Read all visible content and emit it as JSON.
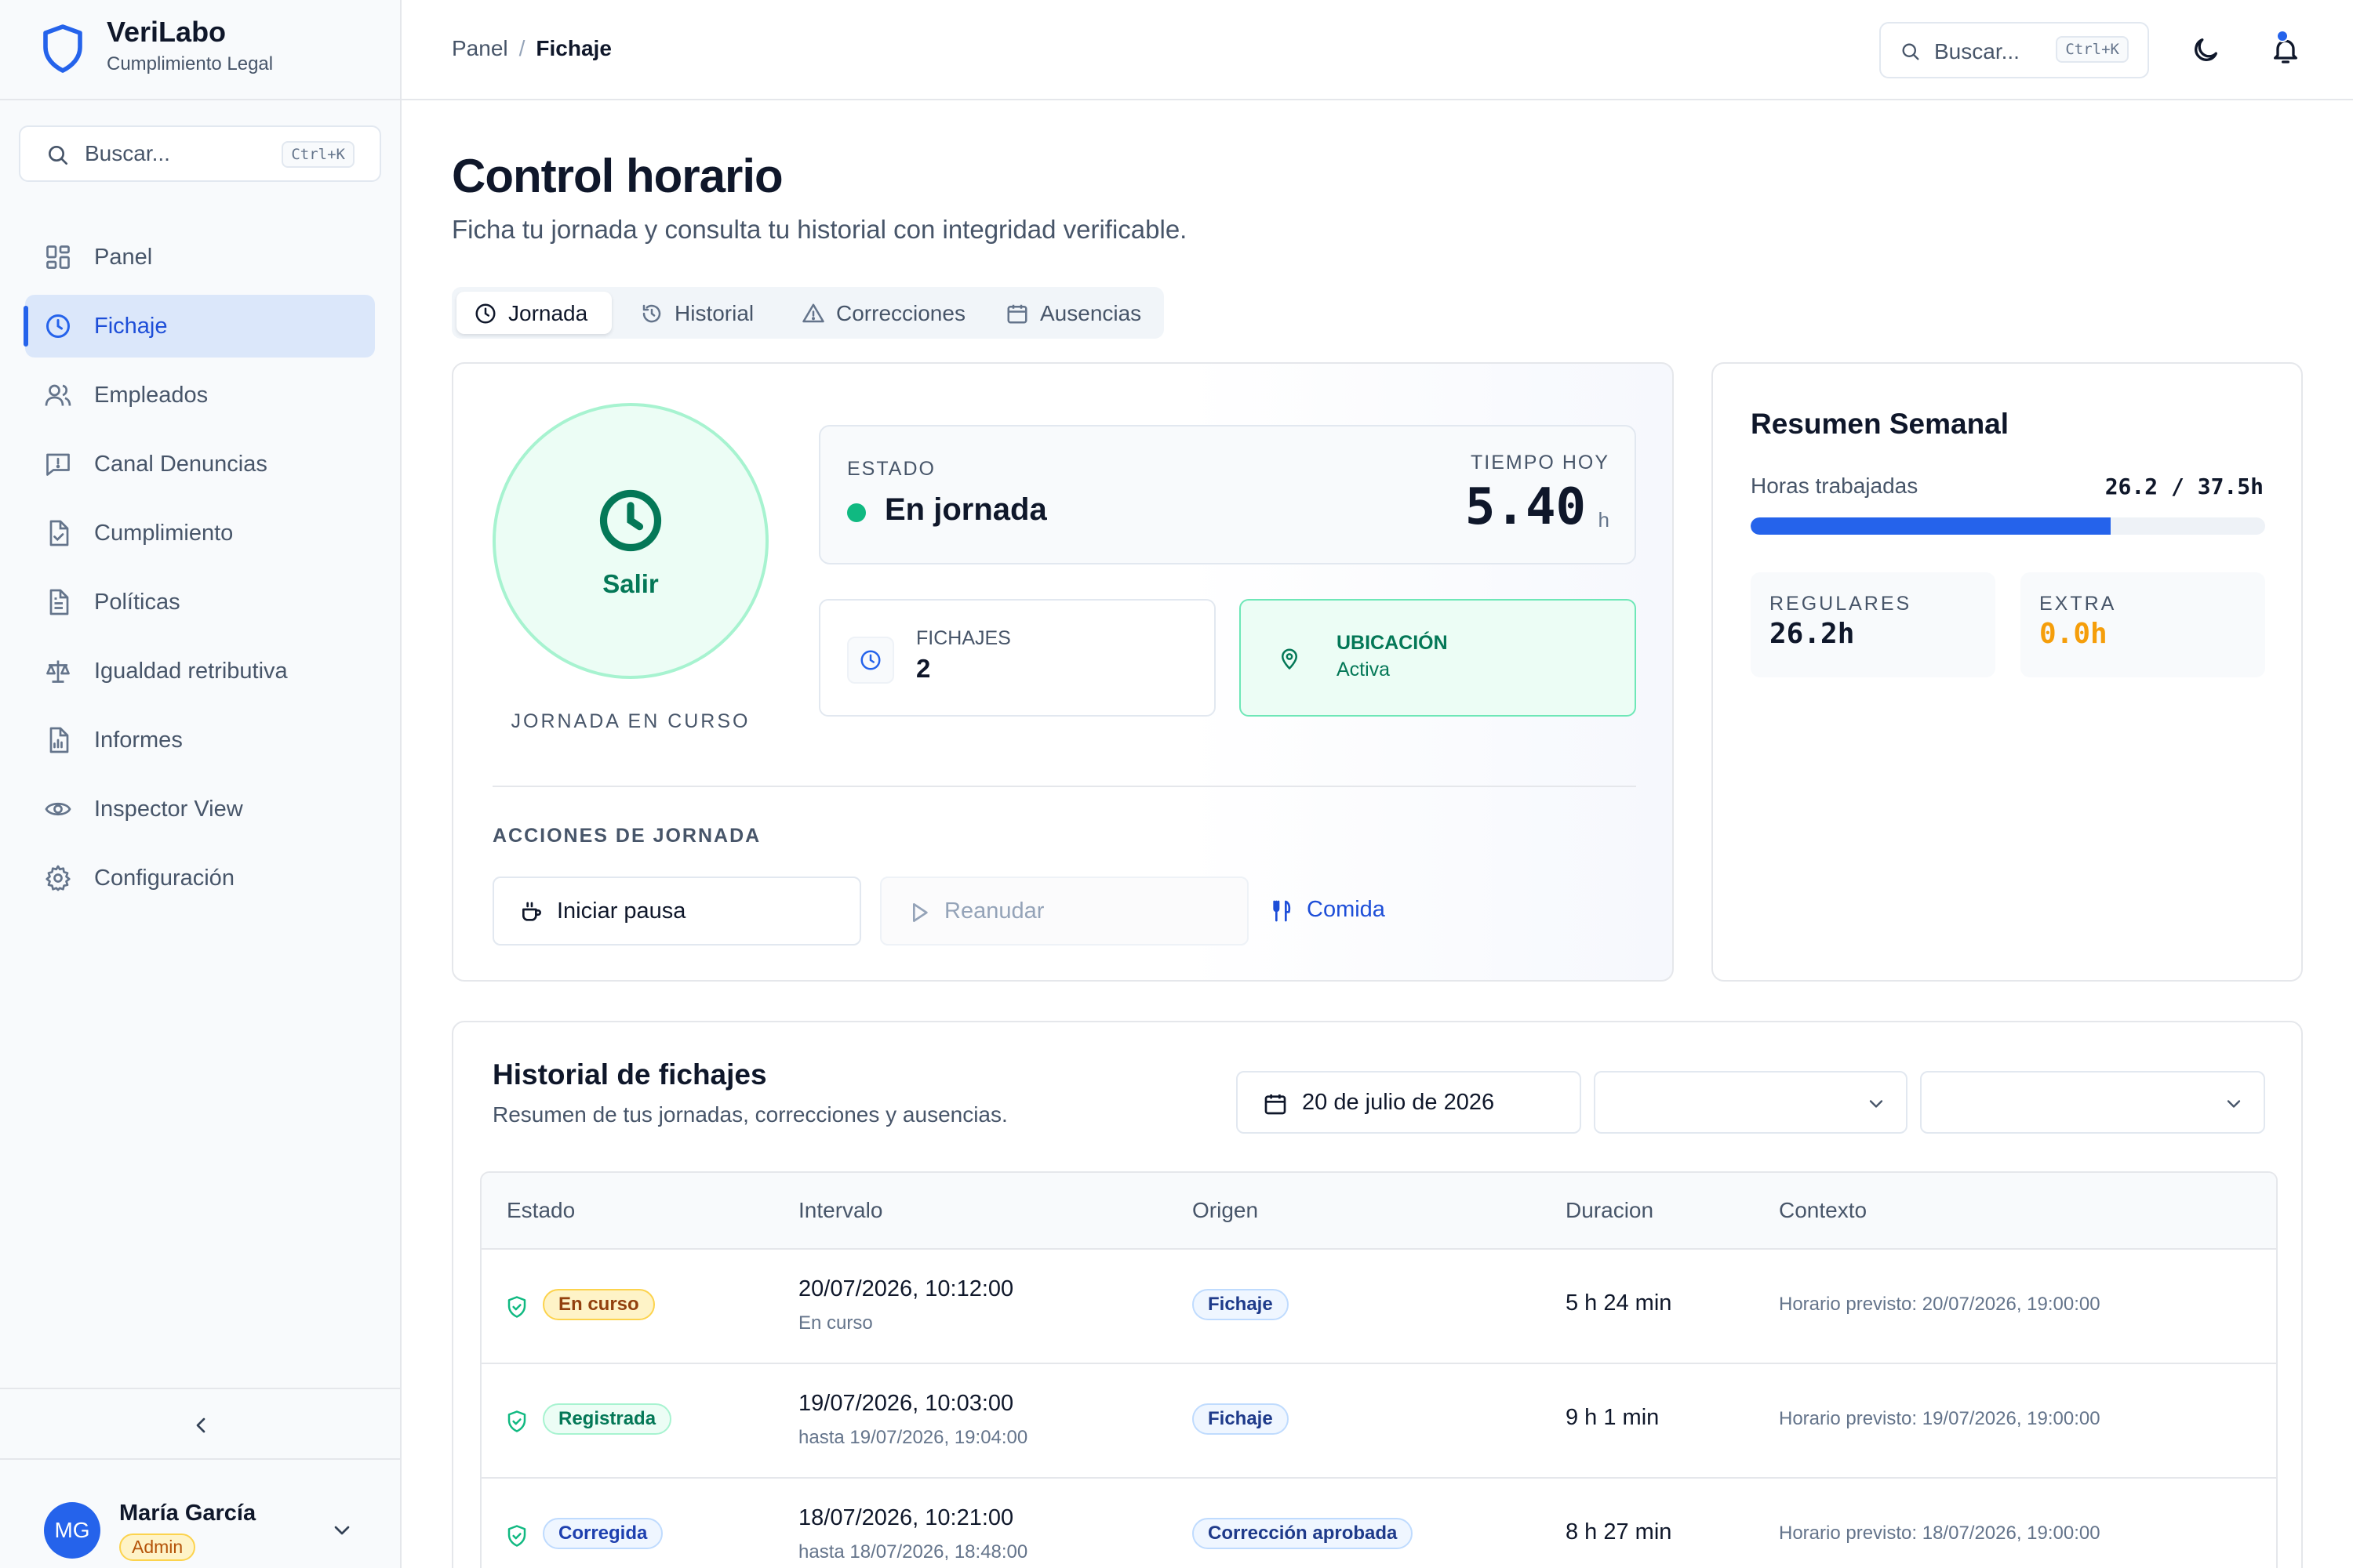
{
  "brand": {
    "name": "VeriLabo",
    "subtitle": "Cumplimiento Legal"
  },
  "sidebar": {
    "search_placeholder": "Buscar...",
    "search_shortcut": "Ctrl+K",
    "items": [
      {
        "label": "Panel",
        "icon": "dashboard-icon",
        "active": false
      },
      {
        "label": "Fichaje",
        "icon": "clock-icon",
        "active": true
      },
      {
        "label": "Empleados",
        "icon": "users-icon",
        "active": false
      },
      {
        "label": "Canal Denuncias",
        "icon": "message-alert-icon",
        "active": false
      },
      {
        "label": "Cumplimiento",
        "icon": "file-check-icon",
        "active": false
      },
      {
        "label": "Políticas",
        "icon": "file-text-icon",
        "active": false
      },
      {
        "label": "Igualdad retributiva",
        "icon": "scale-icon",
        "active": false
      },
      {
        "label": "Informes",
        "icon": "report-icon",
        "active": false
      },
      {
        "label": "Inspector View",
        "icon": "eye-icon",
        "active": false
      },
      {
        "label": "Configuración",
        "icon": "gear-icon",
        "active": false
      }
    ],
    "user": {
      "initials": "MG",
      "name": "María García",
      "role": "Admin"
    }
  },
  "header": {
    "breadcrumb": [
      "Panel",
      "Fichaje"
    ],
    "search_placeholder": "Buscar...",
    "search_shortcut": "Ctrl+K"
  },
  "page": {
    "title": "Control horario",
    "subtitle": "Ficha tu jornada y consulta tu historial con integridad verificable."
  },
  "tabs": [
    {
      "label": "Jornada",
      "icon": "clock-icon",
      "active": true
    },
    {
      "label": "Historial",
      "icon": "history-icon",
      "active": false
    },
    {
      "label": "Correcciones",
      "icon": "warning-icon",
      "active": false
    },
    {
      "label": "Ausencias",
      "icon": "calendar-icon",
      "active": false
    }
  ],
  "jornada": {
    "clock_button": "Salir",
    "clock_caption": "JORNADA EN CURSO",
    "status_label": "ESTADO",
    "status_value": "En jornada",
    "time_label": "TIEMPO HOY",
    "time_value": "5.40",
    "time_unit": "h",
    "fichajes_label": "FICHAJES",
    "fichajes_value": "2",
    "ubicacion_label": "UBICACIÓN",
    "ubicacion_value": "Activa",
    "actions_label": "ACCIONES DE JORNADA",
    "actions": {
      "pause": "Iniciar pausa",
      "resume": "Reanudar",
      "meal": "Comida"
    }
  },
  "weekly": {
    "title": "Resumen Semanal",
    "hours_label": "Horas trabajadas",
    "hours_value": "26.2 / 37.5h",
    "progress": 0.699,
    "regular_label": "REGULARES",
    "regular_value": "26.2h",
    "extra_label": "EXTRA",
    "extra_value": "0.0h"
  },
  "history": {
    "title": "Historial de fichajes",
    "subtitle": "Resumen de tus jornadas, correcciones y ausencias.",
    "date_filter": "20 de julio de 2026",
    "columns": [
      "Estado",
      "Intervalo",
      "Origen",
      "Duracion",
      "Contexto"
    ],
    "rows": [
      {
        "status": "En curso",
        "tone": "amber",
        "start": "20/07/2026, 10:12:00",
        "end": "En curso",
        "origin": "Fichaje",
        "duration": "5 h 24 min",
        "context": "Horario previsto: 20/07/2026, 19:00:00"
      },
      {
        "status": "Registrada",
        "tone": "green",
        "start": "19/07/2026, 10:03:00",
        "end": "hasta 19/07/2026, 19:04:00",
        "origin": "Fichaje",
        "duration": "9 h 1 min",
        "context": "Horario previsto: 19/07/2026, 19:00:00"
      },
      {
        "status": "Corregida",
        "tone": "blue",
        "start": "18/07/2026, 10:21:00",
        "end": "hasta 18/07/2026, 18:48:00",
        "origin": "Corrección aprobada",
        "duration": "8 h 27 min",
        "context": "Horario previsto: 18/07/2026, 19:00:00"
      }
    ]
  },
  "colors": {
    "accent": "#2563eb",
    "success": "#10b981",
    "warning": "#f59e0b"
  }
}
